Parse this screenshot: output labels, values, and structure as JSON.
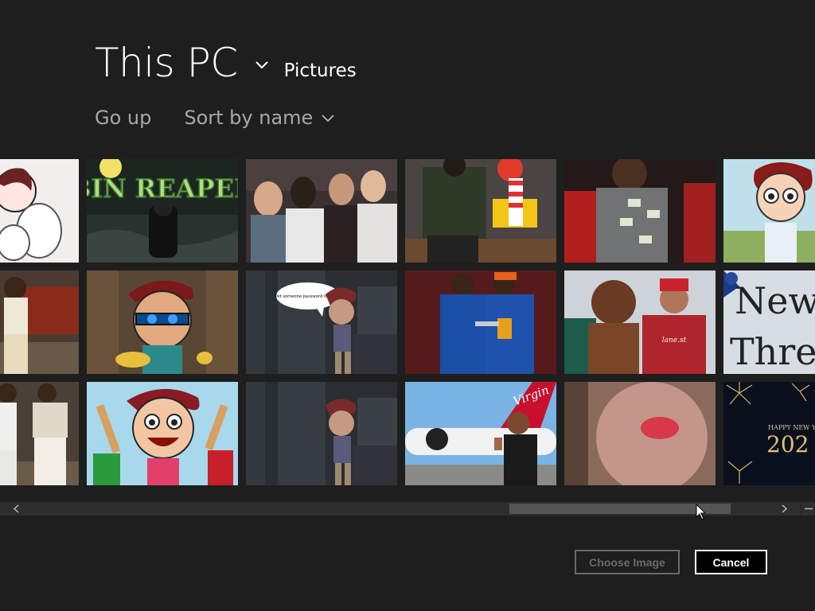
{
  "location": {
    "root": "This PC",
    "folder": "Pictures"
  },
  "commands": {
    "go_up": "Go up",
    "sort": "Sort by name"
  },
  "tiles": [
    {
      "name": "tile-r1c1",
      "caption": ""
    },
    {
      "name": "tile-bin-reaper",
      "caption": "BIN REAPER"
    },
    {
      "name": "tile-r1c3",
      "caption": ""
    },
    {
      "name": "tile-r1c4",
      "caption": ""
    },
    {
      "name": "tile-r1c5",
      "caption": ""
    },
    {
      "name": "tile-r1c6",
      "caption": ""
    },
    {
      "name": "tile-r2c1",
      "caption": ""
    },
    {
      "name": "tile-r2c2",
      "caption": ""
    },
    {
      "name": "tile-speech-bubble",
      "caption": "Did someone password it again?"
    },
    {
      "name": "tile-r2c4",
      "caption": ""
    },
    {
      "name": "tile-r2c5",
      "caption": ""
    },
    {
      "name": "tile-new-thread",
      "caption": "New Thre"
    },
    {
      "name": "tile-r3c1",
      "caption": ""
    },
    {
      "name": "tile-r3c2",
      "caption": ""
    },
    {
      "name": "tile-r3c3",
      "caption": ""
    },
    {
      "name": "tile-virgin-plane",
      "caption": "Virgin"
    },
    {
      "name": "tile-r3c5",
      "caption": ""
    },
    {
      "name": "tile-happy-new-year",
      "caption": "HAPPY NEW Y",
      "caption2": "202"
    }
  ],
  "buttons": {
    "choose": "Choose Image",
    "cancel": "Cancel"
  },
  "colors": {
    "background": "#1e1e1e",
    "muted_text": "#a8a8a8",
    "disabled": "#6a6a6a",
    "scroll_thumb": "#555555"
  },
  "icons": [
    "chevron-down-icon",
    "scroll-left-arrow-icon",
    "scroll-right-arrow-icon",
    "minus-icon",
    "mouse-pointer-icon"
  ]
}
